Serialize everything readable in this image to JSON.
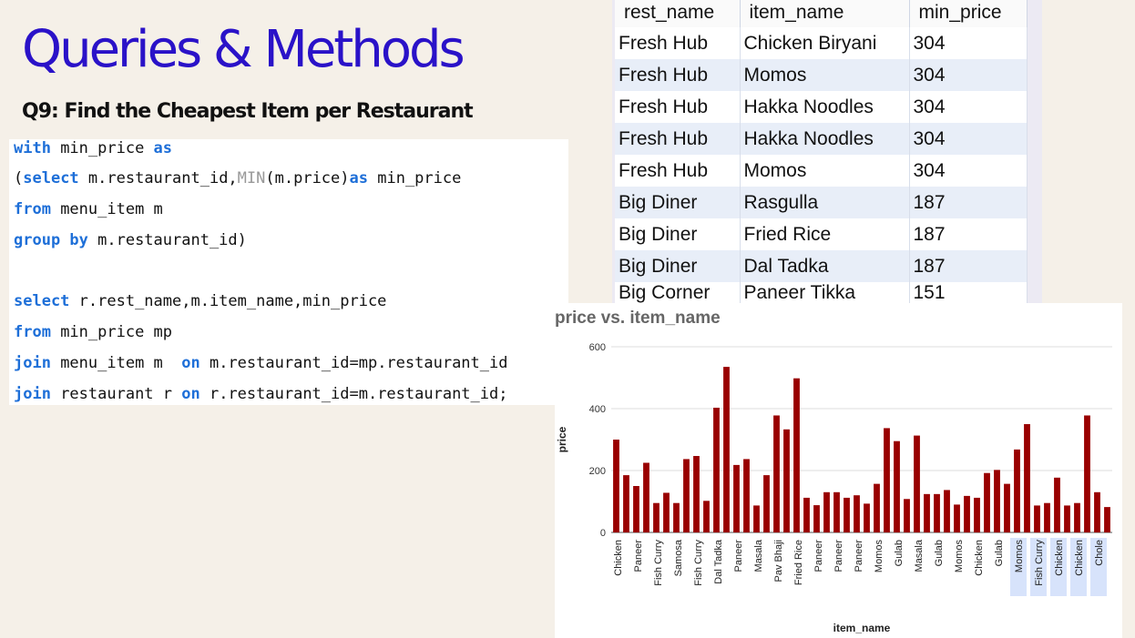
{
  "slide": {
    "title": "Queries & Methods",
    "subtitle": "Q9: Find the Cheapest Item per Restaurant"
  },
  "code": {
    "lines": [
      [
        {
          "t": "with",
          "c": "kw"
        },
        {
          "t": " min_price ",
          "c": ""
        },
        {
          "t": "as",
          "c": "kw"
        }
      ],
      [
        {
          "t": "(",
          "c": ""
        },
        {
          "t": "select",
          "c": "kw"
        },
        {
          "t": " m.restaurant_id,",
          "c": ""
        },
        {
          "t": "MIN",
          "c": "fn"
        },
        {
          "t": "(m.price)",
          "c": ""
        },
        {
          "t": "as",
          "c": "kw"
        },
        {
          "t": " min_price",
          "c": ""
        }
      ],
      [
        {
          "t": "from",
          "c": "kw"
        },
        {
          "t": " menu_item m",
          "c": ""
        }
      ],
      [
        {
          "t": "group by",
          "c": "kw"
        },
        {
          "t": " m.restaurant_id)",
          "c": ""
        }
      ],
      [],
      [
        {
          "t": "select",
          "c": "kw"
        },
        {
          "t": " r.rest_name,m.item_name,min_price",
          "c": ""
        }
      ],
      [
        {
          "t": "from",
          "c": "kw"
        },
        {
          "t": " min_price mp",
          "c": ""
        }
      ],
      [
        {
          "t": "join",
          "c": "kw"
        },
        {
          "t": " menu_item m  ",
          "c": ""
        },
        {
          "t": "on",
          "c": "kw"
        },
        {
          "t": " m.restaurant_id=mp.restaurant_id",
          "c": ""
        }
      ],
      [
        {
          "t": "join",
          "c": "kw"
        },
        {
          "t": " restaurant r ",
          "c": ""
        },
        {
          "t": "on",
          "c": "kw"
        },
        {
          "t": " r.restaurant_id=m.restaurant_id;",
          "c": ""
        }
      ]
    ]
  },
  "result_grid": {
    "columns": [
      "rest_name",
      "item_name",
      "min_price"
    ],
    "rows": [
      [
        "Fresh Hub",
        "Chicken Biryani",
        "304"
      ],
      [
        "Fresh Hub",
        "Momos",
        "304"
      ],
      [
        "Fresh Hub",
        "Hakka Noodles",
        "304"
      ],
      [
        "Fresh Hub",
        "Hakka Noodles",
        "304"
      ],
      [
        "Fresh Hub",
        "Momos",
        "304"
      ],
      [
        "Big Diner",
        "Rasgulla",
        "187"
      ],
      [
        "Big Diner",
        "Fried Rice",
        "187"
      ],
      [
        "Big Diner",
        "Dal Tadka",
        "187"
      ]
    ],
    "partial_row": [
      "Big Corner",
      "Paneer Tikka",
      "151"
    ]
  },
  "chart_data": {
    "type": "bar",
    "title": "price vs. item_name",
    "xlabel": "item_name",
    "ylabel": "price",
    "ylim": [
      0,
      600
    ],
    "yticks": [
      0,
      200,
      400,
      600
    ],
    "grid": true,
    "bar_color": "#990000",
    "highlight_color": "#d7e3fb",
    "values": [
      300,
      185,
      150,
      225,
      95,
      128,
      95,
      237,
      247,
      102,
      403,
      535,
      218,
      237,
      87,
      185,
      378,
      333,
      498,
      112,
      88,
      130,
      130,
      112,
      120,
      93,
      157,
      337,
      295,
      108,
      313,
      124,
      124,
      137,
      90,
      118,
      112,
      192,
      202,
      157,
      268,
      350,
      87,
      95,
      177,
      87,
      95,
      378,
      130,
      82
    ],
    "tick_labels": [
      "Chicken",
      "Paneer",
      "Fish Curry",
      "Samosa",
      "Fish Curry",
      "Dal Tadka",
      "Paneer",
      "Masala",
      "Pav Bhaji",
      "Fried Rice",
      "Paneer",
      "Paneer",
      "Paneer",
      "Momos",
      "Gulab",
      "Masala",
      "Gulab",
      "Momos",
      "Chicken",
      "Gulab",
      "Momos",
      "Fish Curry",
      "Chicken",
      "Chicken",
      "Chole"
    ],
    "highlighted_tick_labels": [
      "Momos",
      "Fish Curry",
      "Chicken",
      "Chicken",
      "Chole"
    ]
  }
}
